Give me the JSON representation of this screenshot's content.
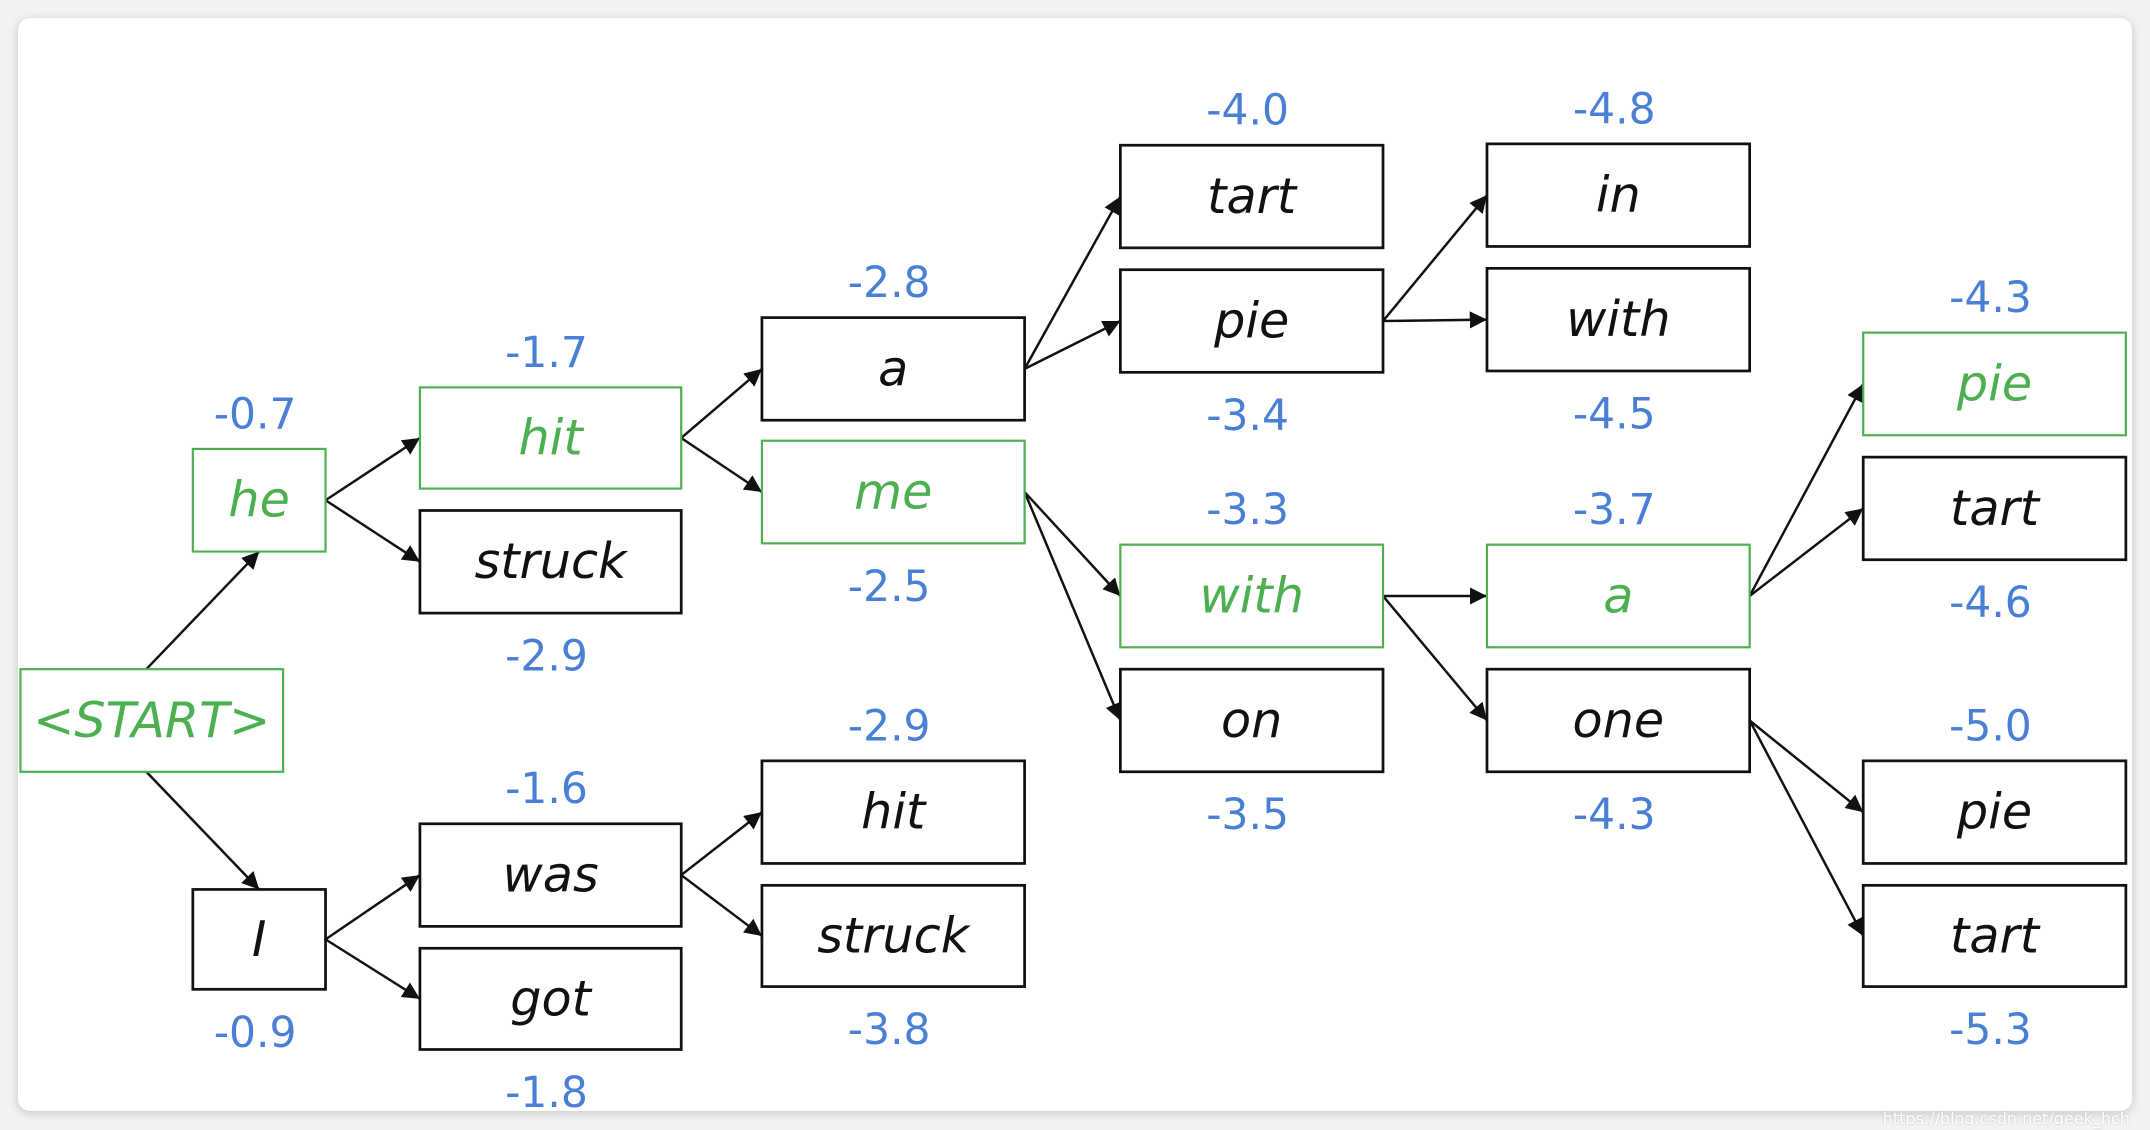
{
  "colors": {
    "selected": "#4caf50",
    "normal": "#111111",
    "score": "#4a7fd6"
  },
  "watermark": "https://blog.csdn.net/geek_hch",
  "nodes": [
    {
      "id": "start",
      "label": "<START>",
      "score": "",
      "selected": true
    },
    {
      "id": "he",
      "label": "he",
      "score": "-0.7",
      "selected": true
    },
    {
      "id": "I",
      "label": "I",
      "score": "-0.9",
      "selected": false
    },
    {
      "id": "hit1",
      "label": "hit",
      "score": "-1.7",
      "selected": true
    },
    {
      "id": "struck1",
      "label": "struck",
      "score": "-2.9",
      "selected": false
    },
    {
      "id": "was",
      "label": "was",
      "score": "-1.6",
      "selected": false
    },
    {
      "id": "got",
      "label": "got",
      "score": "-1.8",
      "selected": false
    },
    {
      "id": "a1",
      "label": "a",
      "score": "-2.8",
      "selected": false
    },
    {
      "id": "me",
      "label": "me",
      "score": "-2.5",
      "selected": true
    },
    {
      "id": "hit2",
      "label": "hit",
      "score": "-2.9",
      "selected": false
    },
    {
      "id": "struck2",
      "label": "struck",
      "score": "-3.8",
      "selected": false
    },
    {
      "id": "tart1",
      "label": "tart",
      "score": "-4.0",
      "selected": false
    },
    {
      "id": "pie1",
      "label": "pie",
      "score": "-3.4",
      "selected": false
    },
    {
      "id": "with1",
      "label": "with",
      "score": "-3.3",
      "selected": true
    },
    {
      "id": "on",
      "label": "on",
      "score": "-3.5",
      "selected": false
    },
    {
      "id": "in",
      "label": "in",
      "score": "-4.8",
      "selected": false
    },
    {
      "id": "with2",
      "label": "with",
      "score": "-4.5",
      "selected": false
    },
    {
      "id": "a2",
      "label": "a",
      "score": "-3.7",
      "selected": true
    },
    {
      "id": "one",
      "label": "one",
      "score": "-4.3",
      "selected": false
    },
    {
      "id": "pie2",
      "label": "pie",
      "score": "-4.3",
      "selected": true
    },
    {
      "id": "tart2",
      "label": "tart",
      "score": "-4.6",
      "selected": false
    },
    {
      "id": "pie3",
      "label": "pie",
      "score": "-5.0",
      "selected": false
    },
    {
      "id": "tart3",
      "label": "tart",
      "score": "-5.3",
      "selected": false
    }
  ],
  "edges": [
    [
      "start",
      "he"
    ],
    [
      "start",
      "I"
    ],
    [
      "he",
      "hit1"
    ],
    [
      "he",
      "struck1"
    ],
    [
      "I",
      "was"
    ],
    [
      "I",
      "got"
    ],
    [
      "hit1",
      "a1"
    ],
    [
      "hit1",
      "me"
    ],
    [
      "was",
      "hit2"
    ],
    [
      "was",
      "struck2"
    ],
    [
      "a1",
      "tart1"
    ],
    [
      "a1",
      "pie1"
    ],
    [
      "me",
      "with1"
    ],
    [
      "me",
      "on"
    ],
    [
      "pie1",
      "in"
    ],
    [
      "pie1",
      "with2"
    ],
    [
      "with1",
      "a2"
    ],
    [
      "with1",
      "one"
    ],
    [
      "a2",
      "pie2"
    ],
    [
      "a2",
      "tart2"
    ],
    [
      "one",
      "pie3"
    ],
    [
      "one",
      "tart3"
    ]
  ]
}
